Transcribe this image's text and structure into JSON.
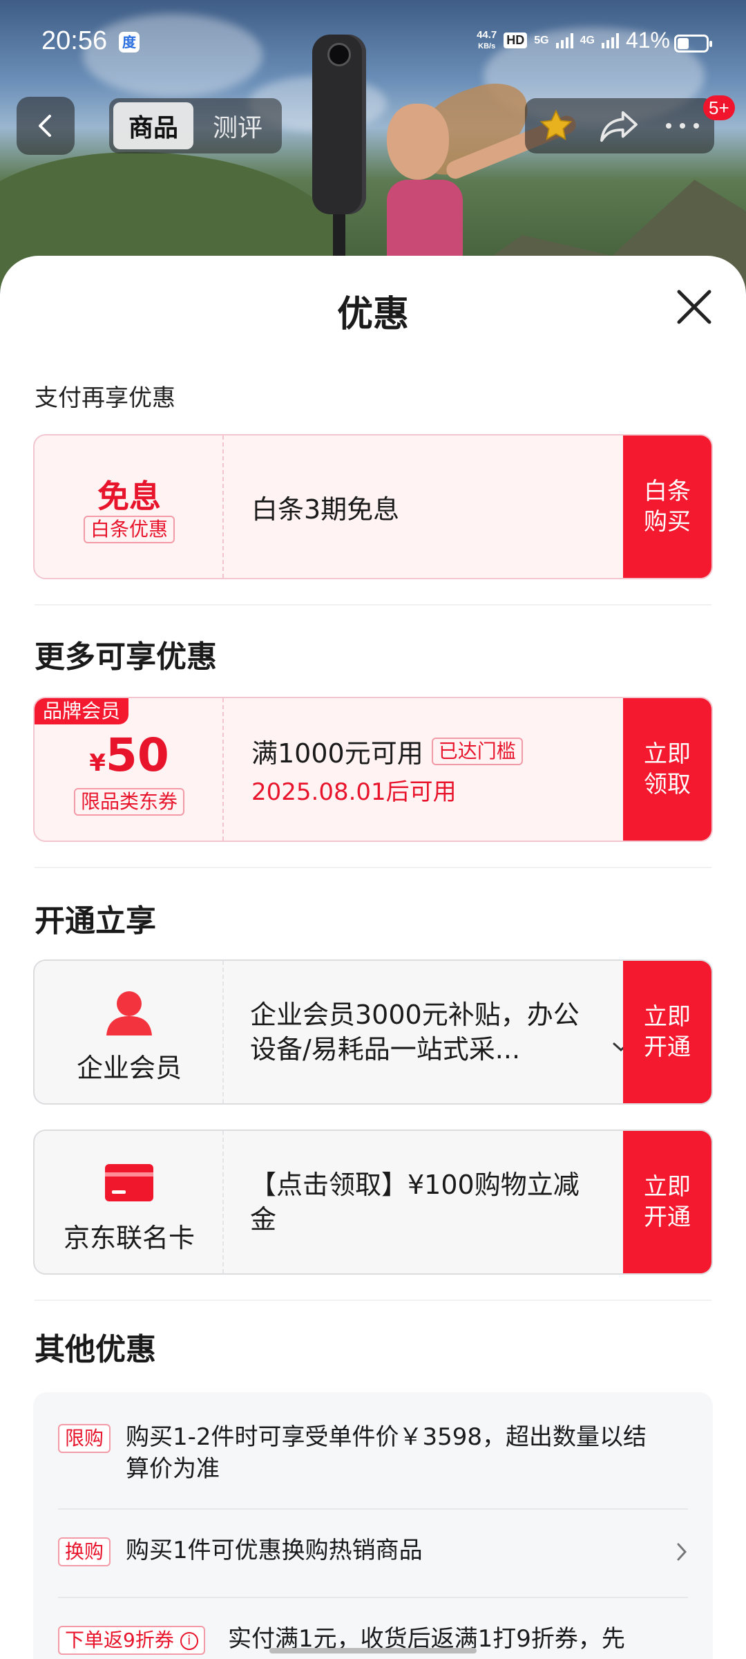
{
  "status_bar": {
    "time": "20:56",
    "app_icon": "baidu-paw-icon",
    "speed": "44.7",
    "speed_unit": "KB/s",
    "hd": "HD",
    "net1": "5G",
    "net2": "4G",
    "battery": "41%"
  },
  "nav": {
    "tabs": [
      {
        "label": "商品",
        "active": true
      },
      {
        "label": "测评",
        "active": false
      }
    ],
    "message_badge": "5+"
  },
  "sheet": {
    "title": "优惠",
    "pay_section_title": "支付再享优惠",
    "pay_coupon": {
      "headline": "免息",
      "tag": "白条优惠",
      "desc": "白条3期免息",
      "action": "白条购买"
    },
    "more_section_title": "更多可享优惠",
    "brand_coupon": {
      "corner_tag": "品牌会员",
      "currency": "¥",
      "amount": "50",
      "tag": "限品类东券",
      "condition": "满1000元可用",
      "reached": "已达门槛",
      "valid": "2025.08.01后可用",
      "action": "立即领取"
    },
    "open_section_title": "开通立享",
    "enterprise": {
      "name": "企业会员",
      "icon": "person-icon",
      "desc": "企业会员3000元补贴，办公设备/易耗品一站式采...",
      "action": "立即开通"
    },
    "jd_card": {
      "name": "京东联名卡",
      "icon": "credit-card-icon",
      "desc": "【点击领取】¥100购物立减金",
      "action": "立即开通"
    },
    "other_section_title": "其他优惠",
    "other_items": [
      {
        "tag": "限购",
        "text": "购买1-2件时可享受单件价￥3598，超出数量以结算价为准"
      },
      {
        "tag": "换购",
        "text": "购买1件可优惠换购热销商品"
      },
      {
        "tag": "下单返9折券",
        "text": "实付满1元，收货后返满1打9折券，先"
      }
    ]
  },
  "colors": {
    "accent_red": "#f5192f",
    "coupon_bg": "#fff3f4",
    "tag_red": "#e8142b"
  }
}
